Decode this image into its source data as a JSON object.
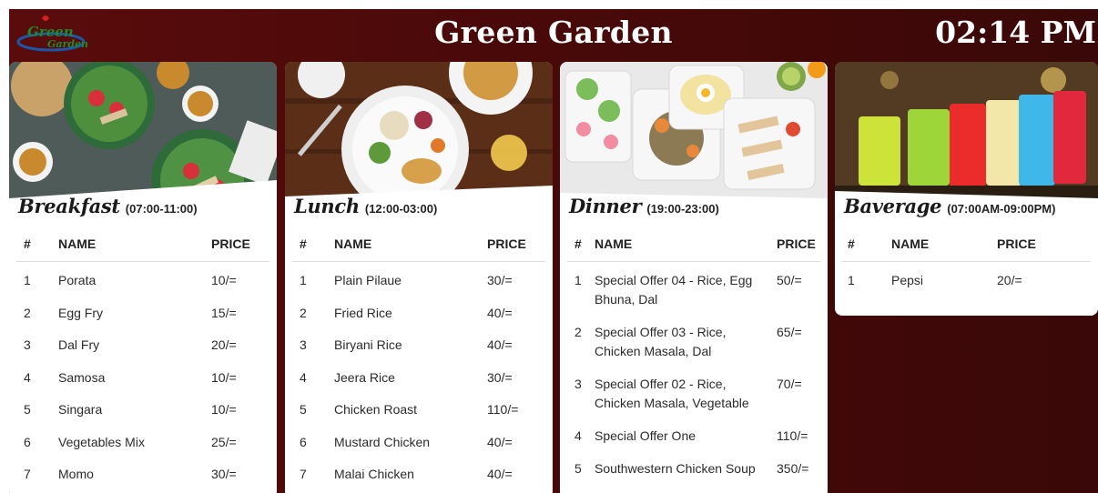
{
  "header": {
    "logo_text_line1": "Green",
    "logo_text_line2": "Garden",
    "title": "Green Garden",
    "clock": "02:14 PM"
  },
  "columns": {
    "num": "#",
    "name": "NAME",
    "price": "PRICE"
  },
  "menus": [
    {
      "title": "Breakfast",
      "hours": "(07:00-11:00)",
      "items": [
        {
          "num": "1",
          "name": "Porata",
          "price": "10/="
        },
        {
          "num": "2",
          "name": "Egg Fry",
          "price": "15/="
        },
        {
          "num": "3",
          "name": "Dal Fry",
          "price": "20/="
        },
        {
          "num": "4",
          "name": "Samosa",
          "price": "10/="
        },
        {
          "num": "5",
          "name": "Singara",
          "price": "10/="
        },
        {
          "num": "6",
          "name": "Vegetables Mix",
          "price": "25/="
        },
        {
          "num": "7",
          "name": "Momo",
          "price": "30/="
        }
      ]
    },
    {
      "title": "Lunch",
      "hours": "(12:00-03:00)",
      "items": [
        {
          "num": "1",
          "name": "Plain Pilaue",
          "price": "30/="
        },
        {
          "num": "2",
          "name": "Fried Rice",
          "price": "40/="
        },
        {
          "num": "3",
          "name": "Biryani Rice",
          "price": "40/="
        },
        {
          "num": "4",
          "name": "Jeera Rice",
          "price": "30/="
        },
        {
          "num": "5",
          "name": "Chicken Roast",
          "price": "110/="
        },
        {
          "num": "6",
          "name": "Mustard Chicken",
          "price": "40/="
        },
        {
          "num": "7",
          "name": "Malai Chicken",
          "price": "40/="
        }
      ]
    },
    {
      "title": "Dinner",
      "hours": "(19:00-23:00)",
      "items": [
        {
          "num": "1",
          "name": "Special Offer 04 - Rice, Egg Bhuna, Dal",
          "price": "50/="
        },
        {
          "num": "2",
          "name": "Special Offer 03 - Rice, Chicken Masala, Dal",
          "price": "65/="
        },
        {
          "num": "3",
          "name": "Special Offer 02 - Rice, Chicken Masala, Vegetable",
          "price": "70/="
        },
        {
          "num": "4",
          "name": "Special Offer One",
          "price": "110/="
        },
        {
          "num": "5",
          "name": "Southwestern Chicken Soup",
          "price": "350/="
        }
      ]
    },
    {
      "title": "Baverage",
      "hours": "(07:00AM-09:00PM)",
      "items": [
        {
          "num": "1",
          "name": "Pepsi",
          "price": "20/="
        }
      ]
    }
  ],
  "colors": {
    "background": "#4a0909",
    "card": "#ffffff",
    "text": "#2b2b2b"
  }
}
